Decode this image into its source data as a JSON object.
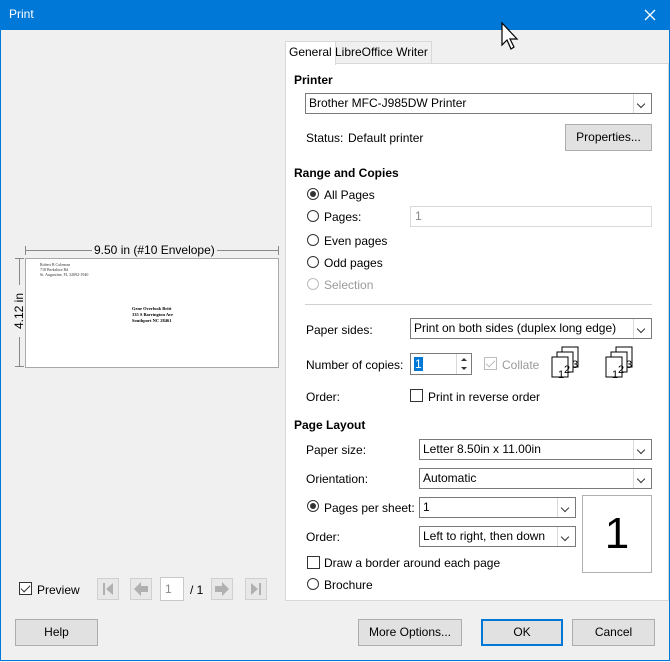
{
  "window": {
    "title": "Print"
  },
  "tabs": [
    {
      "label": "General"
    },
    {
      "label": "LibreOffice Writer"
    }
  ],
  "preview": {
    "width_label": "9.50 in (#10 Envelope)",
    "height_label": "4.12 in",
    "return_address": [
      "Robert B Coleman",
      "718 Berkshire Rd",
      "St. Augustine, FL 32092-1940"
    ],
    "recipient_address": [
      "Gene Overlook Britt",
      "335 S Barrington Ave",
      "Southport NC 28461"
    ],
    "checkbox_label": "Preview",
    "page_current": "1",
    "page_total": "/ 1"
  },
  "printer": {
    "section_title": "Printer",
    "selected": "Brother MFC-J985DW Printer",
    "status_label": "Status:",
    "status_value": "Default printer",
    "properties_button": "Properties..."
  },
  "range": {
    "section_title": "Range and Copies",
    "options": [
      "All Pages",
      "Pages:",
      "Even pages",
      "Odd pages",
      "Selection"
    ],
    "pages_placeholder": "1",
    "paper_sides_label": "Paper sides:",
    "paper_sides_value": "Print on both sides (duplex long edge)",
    "copies_label": "Number of copies:",
    "copies_value": "1",
    "collate_label": "Collate",
    "order_label": "Order:",
    "reverse_label": "Print in reverse order"
  },
  "layout": {
    "section_title": "Page Layout",
    "paper_size_label": "Paper size:",
    "paper_size_value": "Letter 8.50in x 11.00in",
    "orientation_label": "Orientation:",
    "orientation_value": "Automatic",
    "pps_label": "Pages per sheet:",
    "pps_value": "1",
    "order_label": "Order:",
    "order_value": "Left to right, then down",
    "preview_number": "1",
    "border_label": "Draw a border around each page",
    "brochure_label": "Brochure"
  },
  "buttons": {
    "help": "Help",
    "more_options": "More Options...",
    "ok": "OK",
    "cancel": "Cancel"
  },
  "colors": {
    "title_bar": "#0078d7",
    "ok_border": "#0078d7"
  }
}
